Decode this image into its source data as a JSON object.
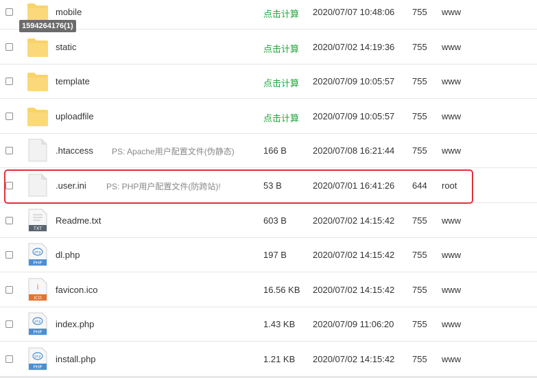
{
  "files": [
    {
      "name": "mobile",
      "type": "folder",
      "ps": "",
      "size": "点击计算",
      "size_is_link": true,
      "modified": "2020/07/07 10:48:06",
      "perm": "755",
      "owner": "www"
    },
    {
      "name": "static",
      "type": "folder",
      "ps": "",
      "size": "点击计算",
      "size_is_link": true,
      "modified": "2020/07/02 14:19:36",
      "perm": "755",
      "owner": "www"
    },
    {
      "name": "template",
      "type": "folder",
      "ps": "",
      "size": "点击计算",
      "size_is_link": true,
      "modified": "2020/07/09 10:05:57",
      "perm": "755",
      "owner": "www"
    },
    {
      "name": "uploadfile",
      "type": "folder",
      "ps": "",
      "size": "点击计算",
      "size_is_link": true,
      "modified": "2020/07/09 10:05:57",
      "perm": "755",
      "owner": "www"
    },
    {
      "name": ".htaccess",
      "type": "file",
      "ps": "PS: Apache用户配置文件(伪静态)",
      "size": "166 B",
      "modified": "2020/07/08 16:21:44",
      "perm": "755",
      "owner": "www"
    },
    {
      "name": ".user.ini",
      "type": "file",
      "ps": "PS: PHP用户配置文件(防跨站)!",
      "size": "53 B",
      "modified": "2020/07/01 16:41:26",
      "perm": "644",
      "owner": "root",
      "highlighted": true
    },
    {
      "name": "Readme.txt",
      "type": "txt",
      "badge": "TXT",
      "ps": "",
      "size": "603 B",
      "modified": "2020/07/02 14:15:42",
      "perm": "755",
      "owner": "www"
    },
    {
      "name": "dl.php",
      "type": "php",
      "badge": "PHP",
      "ps": "",
      "size": "197 B",
      "modified": "2020/07/02 14:15:42",
      "perm": "755",
      "owner": "www"
    },
    {
      "name": "favicon.ico",
      "type": "ico",
      "badge": "ICO",
      "ps": "",
      "size": "16.56 KB",
      "modified": "2020/07/02 14:15:42",
      "perm": "755",
      "owner": "www"
    },
    {
      "name": "index.php",
      "type": "php",
      "badge": "PHP",
      "ps": "",
      "size": "1.43 KB",
      "modified": "2020/07/09 11:06:20",
      "perm": "755",
      "owner": "www"
    },
    {
      "name": "install.php",
      "type": "php",
      "badge": "PHP",
      "ps": "",
      "size": "1.21 KB",
      "modified": "2020/07/02 14:15:42",
      "perm": "755",
      "owner": "www"
    }
  ],
  "tooltip": "1594264176(1)",
  "colors": {
    "folder": "#f9d36b",
    "link_green": "#20a53a",
    "php_blue": "#4a8fd6",
    "ico_orange": "#e8732a",
    "txt_gray": "#5a6470",
    "highlight_red": "#e0303a"
  }
}
